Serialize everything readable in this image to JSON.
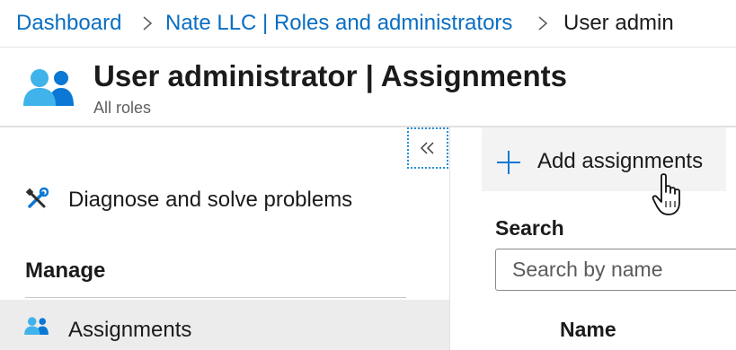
{
  "breadcrumb": {
    "items": [
      {
        "label": "Dashboard",
        "link": true
      },
      {
        "label": "Nate LLC | Roles and administrators",
        "link": true
      },
      {
        "label": "User admin",
        "link": false
      }
    ],
    "separator_icon": "chevron-right-icon"
  },
  "header": {
    "title": "User administrator | Assignments",
    "subtitle": "All roles",
    "icon": "users-icon"
  },
  "sidebar": {
    "collapse_icon": "double-chevron-left-icon",
    "items": [
      {
        "label": "Diagnose and solve problems",
        "icon": "wrench-screwdriver-icon"
      }
    ],
    "section": {
      "title": "Manage",
      "items": [
        {
          "label": "Assignments",
          "icon": "users-icon",
          "selected": true
        }
      ]
    }
  },
  "toolbar": {
    "add_label": "Add assignments",
    "add_icon": "plus-icon"
  },
  "search": {
    "label": "Search",
    "placeholder": "Search by name",
    "value": ""
  },
  "table": {
    "columns": [
      "Name"
    ]
  },
  "colors": {
    "link": "#0a6ec2",
    "icon_blue": "#0a78d4",
    "icon_light_blue": "#40b3ea",
    "selected_bg": "#ececec",
    "command_bg": "#f3f3f3"
  }
}
